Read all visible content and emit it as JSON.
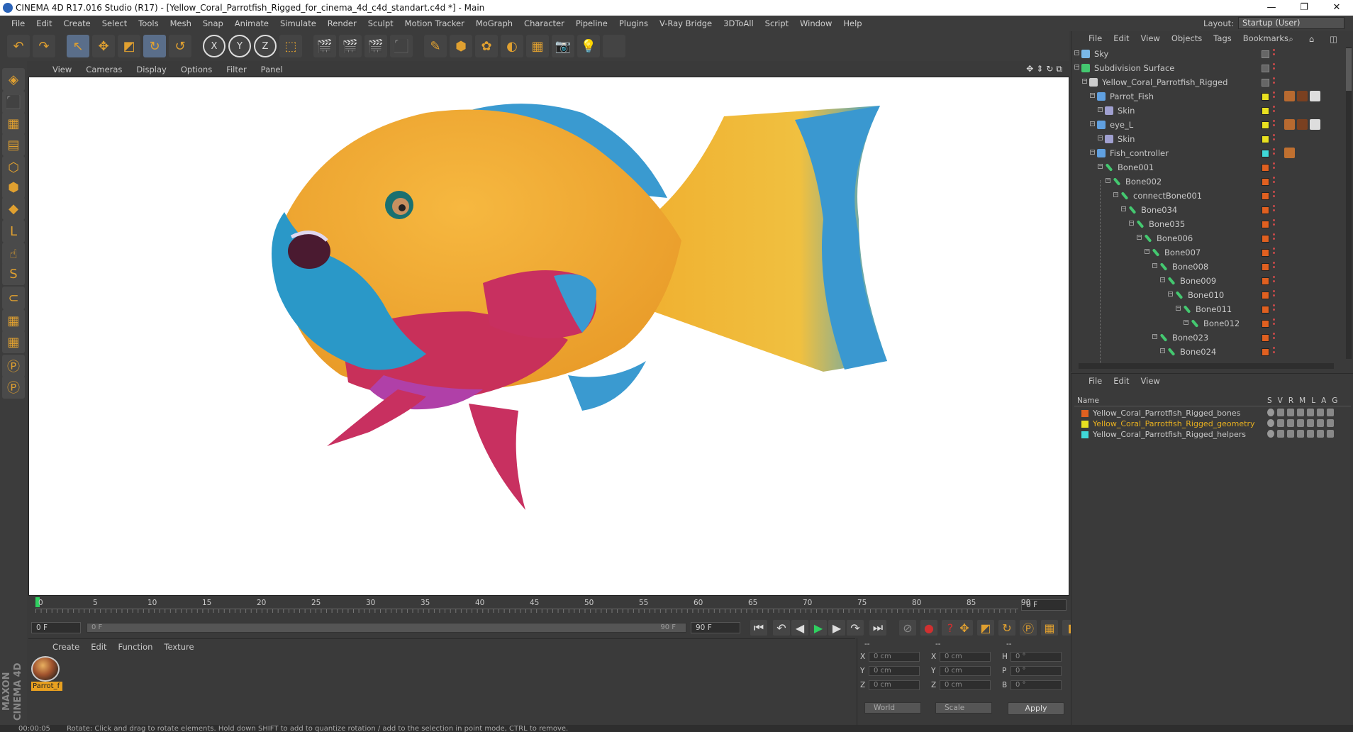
{
  "window": {
    "title": "CINEMA 4D R17.016 Studio (R17) - [Yellow_Coral_Parrotfish_Rigged_for_cinema_4d_c4d_standart.c4d *] - Main",
    "controls": [
      "—",
      "❐",
      "✕"
    ]
  },
  "menubar": [
    "File",
    "Edit",
    "Create",
    "Select",
    "Tools",
    "Mesh",
    "Snap",
    "Animate",
    "Simulate",
    "Render",
    "Sculpt",
    "Motion Tracker",
    "MoGraph",
    "Character",
    "Pipeline",
    "Plugins",
    "V-Ray Bridge",
    "3DToAll",
    "Script",
    "Window",
    "Help"
  ],
  "layout": {
    "label": "Layout:",
    "value": "Startup (User)"
  },
  "toolbar": {
    "icons": [
      "undo-icon",
      "redo-icon",
      "live-selection-icon",
      "move-icon",
      "scale-icon",
      "rotate-icon",
      "recent-tool-icon",
      "x-axis-icon",
      "y-axis-icon",
      "z-axis-icon",
      "coordinate-system-icon",
      "render-view-icon",
      "render-picture-viewer-icon",
      "render-settings-icon",
      "cube-icon",
      "pen-icon",
      "subdivision-icon",
      "array-icon",
      "deformer-icon",
      "floor-icon",
      "camera-icon",
      "light-icon"
    ],
    "glyphs": [
      "↶",
      "↷",
      "↖",
      "✥",
      "◩",
      "↻",
      "↺",
      "X",
      "Y",
      "Z",
      "⬚",
      "🎬",
      "🎬",
      "🎬",
      "⬛",
      "✎",
      "⬢",
      "✿",
      "◐",
      "▦",
      "📷",
      "💡"
    ]
  },
  "viewport": {
    "menu": [
      "View",
      "Cameras",
      "Display",
      "Options",
      "Filter",
      "Panel"
    ],
    "nav": [
      "✥",
      "⇕",
      "↻",
      "⧉"
    ]
  },
  "timeline": {
    "ticks": [
      "0",
      "5",
      "10",
      "15",
      "20",
      "25",
      "30",
      "35",
      "40",
      "45",
      "50",
      "55",
      "60",
      "65",
      "70",
      "75",
      "80",
      "85",
      "90"
    ],
    "current_frame": "0 F",
    "start_field": "0 F",
    "range_start": "0 F",
    "range_end": "90 F",
    "end_field": "90 F"
  },
  "transport": {
    "glyphs": [
      "⏮",
      "↶",
      "◀",
      "▶",
      "▶",
      "↷",
      "⏭"
    ],
    "icons": [
      "goto-start-icon",
      "prev-key-icon",
      "prev-frame-icon",
      "play-icon",
      "next-frame-icon",
      "next-key-icon",
      "goto-end-icon"
    ]
  },
  "material_manager": {
    "menu": [
      "Create",
      "Edit",
      "Function",
      "Texture"
    ],
    "materials": [
      {
        "label": "Parrot_f"
      }
    ]
  },
  "attributes": {
    "headers": [
      "--",
      "--",
      "--"
    ],
    "rows": [
      {
        "a": "X",
        "av": "0 cm",
        "b": "X",
        "bv": "0 cm",
        "c": "H",
        "cv": "0 °"
      },
      {
        "a": "Y",
        "av": "0 cm",
        "b": "Y",
        "bv": "0 cm",
        "c": "P",
        "cv": "0 °"
      },
      {
        "a": "Z",
        "av": "0 cm",
        "b": "Z",
        "bv": "0 cm",
        "c": "B",
        "cv": "0 °"
      }
    ],
    "coord_mode": "World",
    "size_mode": "Scale",
    "apply_label": "Apply"
  },
  "object_manager": {
    "menu": [
      "File",
      "Edit",
      "View",
      "Objects",
      "Tags",
      "Bookmarks"
    ],
    "objects": [
      {
        "name": "Sky",
        "depth": 0,
        "icon_color": "#7ab8e8",
        "layer_color": "",
        "tags": []
      },
      {
        "name": "Subdivision Surface",
        "depth": 0,
        "icon_color": "#44c870",
        "layer_color": "",
        "tags": []
      },
      {
        "name": "Yellow_Coral_Parrotfish_Rigged",
        "depth": 1,
        "icon_color": "#cccccc",
        "layer_color": "",
        "tags": []
      },
      {
        "name": "Parrot_Fish",
        "depth": 2,
        "icon_color": "#60a0e0",
        "layer_color": "#e8e020",
        "tags": [
          "#b86a30",
          "#7a4020",
          "#dddddd"
        ]
      },
      {
        "name": "Skin",
        "depth": 3,
        "icon_color": "#a0a0d0",
        "layer_color": "#e8e020",
        "tags": []
      },
      {
        "name": "eye_L",
        "depth": 2,
        "icon_color": "#60a0e0",
        "layer_color": "#e8e020",
        "tags": [
          "#b86a30",
          "#7a4020",
          "#dddddd"
        ]
      },
      {
        "name": "Skin",
        "depth": 3,
        "icon_color": "#a0a0d0",
        "layer_color": "#e8e020",
        "tags": []
      },
      {
        "name": "Fish_controller",
        "depth": 2,
        "icon_color": "#60a0e0",
        "layer_color": "#40d8d8",
        "tags": [
          "#c07030"
        ]
      },
      {
        "name": "Bone001",
        "depth": 3,
        "icon_color": "#44c870",
        "layer_color": "#e06020",
        "tags": []
      },
      {
        "name": "Bone002",
        "depth": 4,
        "icon_color": "#44c870",
        "layer_color": "#e06020",
        "tags": []
      },
      {
        "name": "connectBone001",
        "depth": 5,
        "icon_color": "#44c870",
        "layer_color": "#e06020",
        "tags": []
      },
      {
        "name": "Bone034",
        "depth": 6,
        "icon_color": "#44c870",
        "layer_color": "#e06020",
        "tags": []
      },
      {
        "name": "Bone035",
        "depth": 7,
        "icon_color": "#44c870",
        "layer_color": "#e06020",
        "tags": []
      },
      {
        "name": "Bone006",
        "depth": 8,
        "icon_color": "#44c870",
        "layer_color": "#e06020",
        "tags": []
      },
      {
        "name": "Bone007",
        "depth": 9,
        "icon_color": "#44c870",
        "layer_color": "#e06020",
        "tags": []
      },
      {
        "name": "Bone008",
        "depth": 10,
        "icon_color": "#44c870",
        "layer_color": "#e06020",
        "tags": []
      },
      {
        "name": "Bone009",
        "depth": 11,
        "icon_color": "#44c870",
        "layer_color": "#e06020",
        "tags": []
      },
      {
        "name": "Bone010",
        "depth": 12,
        "icon_color": "#44c870",
        "layer_color": "#e06020",
        "tags": []
      },
      {
        "name": "Bone011",
        "depth": 13,
        "icon_color": "#44c870",
        "layer_color": "#e06020",
        "tags": []
      },
      {
        "name": "Bone012",
        "depth": 14,
        "icon_color": "#44c870",
        "layer_color": "#e06020",
        "tags": []
      },
      {
        "name": "Bone023",
        "depth": 10,
        "icon_color": "#44c870",
        "layer_color": "#e06020",
        "tags": []
      },
      {
        "name": "Bone024",
        "depth": 11,
        "icon_color": "#44c870",
        "layer_color": "#e06020",
        "tags": []
      }
    ]
  },
  "layer_manager": {
    "menu": [
      "File",
      "Edit",
      "View"
    ],
    "header": {
      "name": "Name",
      "cols": [
        "S",
        "V",
        "R",
        "M",
        "L",
        "A",
        "G"
      ]
    },
    "layers": [
      {
        "name": "Yellow_Coral_Parrotfish_Rigged_bones",
        "color": "#e06020",
        "text_color": "#c8c8c8"
      },
      {
        "name": "Yellow_Coral_Parrotfish_Rigged_geometry",
        "color": "#e8e020",
        "text_color": "#e8b020"
      },
      {
        "name": "Yellow_Coral_Parrotfish_Rigged_helpers",
        "color": "#40d8d8",
        "text_color": "#c8c8c8"
      }
    ]
  },
  "statusbar": {
    "time": "00:00:05",
    "message": "Rotate: Click and drag to rotate elements. Hold down SHIFT to add to quantize rotation / add to the selection in point mode, CTRL to remove."
  },
  "colors": {
    "accent": "#e0a030",
    "play": "#2fd060",
    "selection": "#5a6e8a"
  }
}
